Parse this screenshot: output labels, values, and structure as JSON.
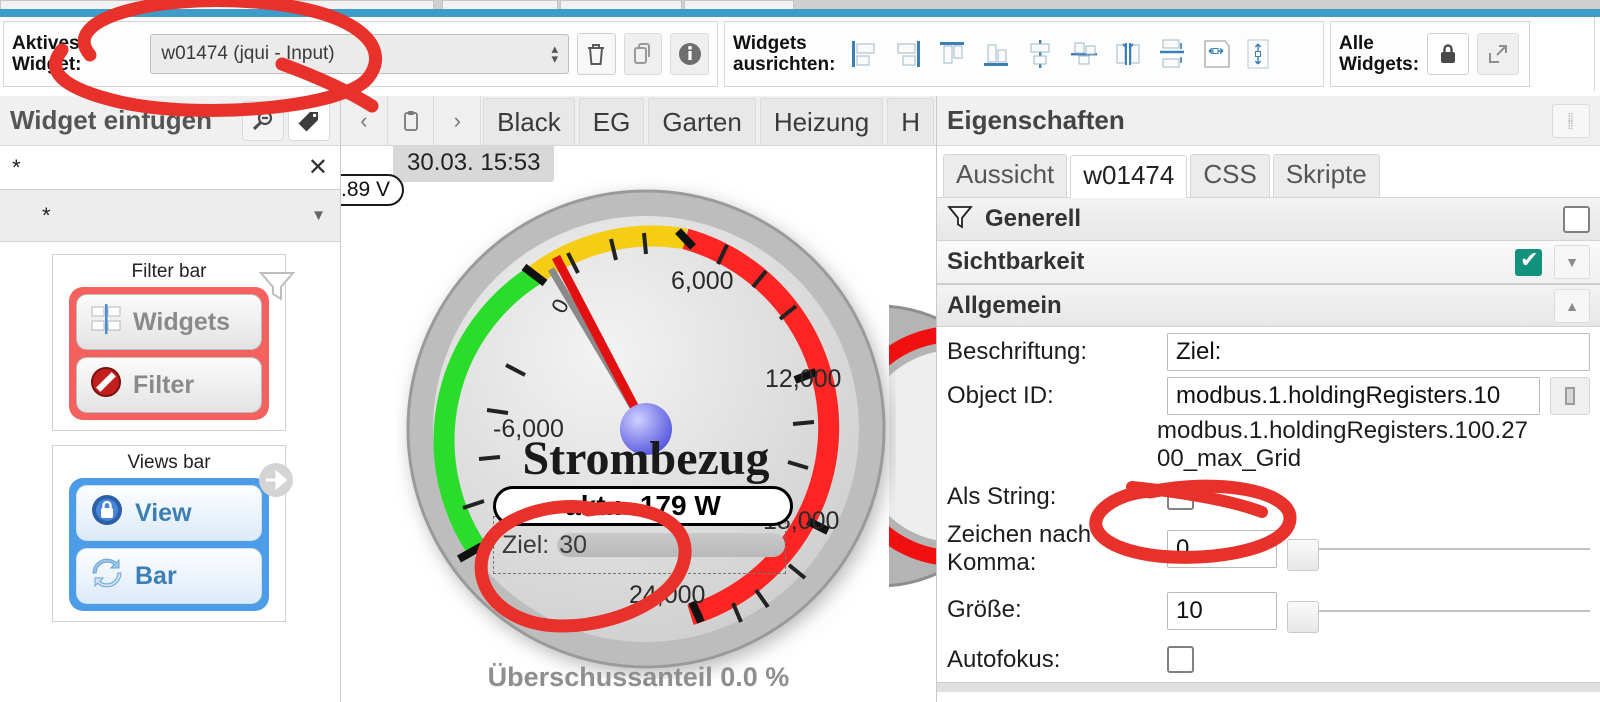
{
  "toolbar": {
    "active_widget_label": "Aktives Widget:",
    "active_widget_value": "w01474 (jqui - Input)",
    "delete_icon": "trash-icon",
    "copy_icon": "copy-icon",
    "info_icon": "info-icon",
    "align_label_line1": "Widgets",
    "align_label_line2": "ausrichten:",
    "align_icons": [
      "align-left-icon",
      "align-right-icon",
      "align-top-icon",
      "align-bottom-icon",
      "align-center-horizontal-icon",
      "align-center-vertical-icon",
      "distribute-horizontal-icon",
      "distribute-vertical-icon",
      "equal-width-icon",
      "equal-height-icon"
    ],
    "all_widgets_label_line1": "Alle",
    "all_widgets_label_line2": "Widgets:",
    "lock_icon": "lock-icon",
    "expand_icon": "expand-icon"
  },
  "left_panel": {
    "title": "Widget einfügen",
    "header_buttons": [
      {
        "icon": "zoom-out-icon",
        "active": false
      },
      {
        "icon": "tag-icon",
        "active": true
      }
    ],
    "search_value": "*",
    "search_clear": "✕",
    "filter_value": "*",
    "cards": [
      {
        "title": "Filter bar",
        "corner_icon": "funnel-icon",
        "highlight_color": "#f4615e",
        "pills": [
          {
            "label": "Widgets",
            "icon": "widgets-icon"
          },
          {
            "label": "Filter",
            "icon": "no-entry-icon"
          }
        ]
      },
      {
        "title": "Views bar",
        "corner_icon": "arrow-right-circle-icon",
        "highlight_color": "#4c9ce8",
        "pills": [
          {
            "label": "View",
            "icon": "lock-circle-icon"
          },
          {
            "label": "Bar",
            "icon": "refresh-icon"
          }
        ]
      }
    ]
  },
  "center": {
    "nav_prev_icon": "chevron-left-icon",
    "nav_paste_icon": "clipboard-icon",
    "nav_next_icon": "chevron-right-icon",
    "tabs": [
      "Black",
      "EG",
      "Garten",
      "Heizung",
      "H"
    ],
    "timestamp_chip": "30.03. 15:53",
    "voltage_chip": ".89 V",
    "gauge": {
      "title": "Strombezug",
      "value_chip": "akt.: -179 W",
      "target_label": "Ziel:",
      "target_value": "30",
      "subtitle": "Überschussanteil 0.0 %",
      "tick_labels": [
        "-6,000",
        "0",
        "6,000",
        "12,000",
        "18,000",
        "24,000"
      ],
      "needle_value": -179,
      "bands": [
        {
          "color": "#2bdd2b",
          "from": -6000,
          "to": 0
        },
        {
          "color": "#f5cd13",
          "from": 0,
          "to": 4500
        },
        {
          "color": "#fd2424",
          "from": 4500,
          "to": 26000
        }
      ],
      "min": -6000,
      "max": 26000
    }
  },
  "right_panel": {
    "title": "Eigenschaften",
    "grip_icon": "drag-grip-icon",
    "tabs": [
      {
        "label": "Aussicht",
        "selected": false
      },
      {
        "label": "w01474",
        "selected": true
      },
      {
        "label": "CSS",
        "selected": false
      },
      {
        "label": "Skripte",
        "selected": false
      }
    ],
    "sections": [
      {
        "name": "Generell",
        "icon": "funnel-icon",
        "checkbox": false
      },
      {
        "name": "Sichtbarkeit",
        "icon": "",
        "checkbox": true,
        "caret": "down"
      },
      {
        "name": "Allgemein",
        "icon": "",
        "caret": "up"
      }
    ],
    "fields": [
      {
        "label": "Beschriftung:",
        "value": "Ziel:",
        "type": "text"
      },
      {
        "label": "Object ID:",
        "value": "modbus.1.holdingRegisters.10",
        "type": "objectid",
        "button_icon": "object-browser-icon"
      },
      {
        "label": "Zeichen nach Komma:",
        "value": "0",
        "type": "number-slider"
      },
      {
        "label": "Größe:",
        "value": "10",
        "type": "number-slider"
      },
      {
        "label": "Autofokus:",
        "value": false,
        "type": "checkbox"
      },
      {
        "label": "Als String:",
        "value": false,
        "type": "checkbox"
      }
    ],
    "object_path_line1": "modbus.1.holdingRegisters.100.27",
    "object_path_line2": "00_max_Grid"
  },
  "annotations": {
    "color": "#e8312a",
    "marks": [
      "ellipse-around-active-widget-select",
      "ellipse-around-ziel-input",
      "ellipse-around-als-string-checkbox"
    ]
  },
  "colors": {
    "accent_blue": "#3e9ccb",
    "annotation_red": "#e8312a",
    "check_green": "#12917d",
    "gauge_green": "#2bdd2b",
    "gauge_yellow": "#f5cd13",
    "gauge_red": "#fd2424"
  }
}
